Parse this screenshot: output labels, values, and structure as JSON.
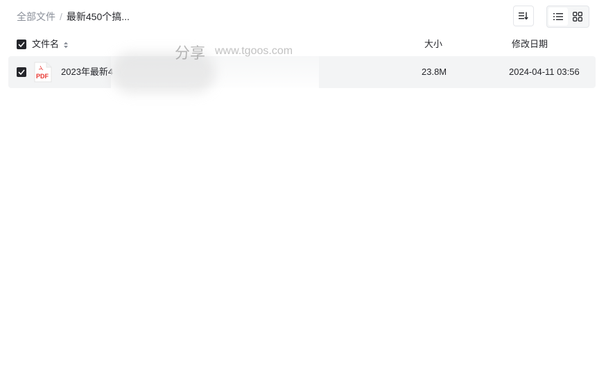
{
  "breadcrumb": {
    "root": "全部文件",
    "separator": "/",
    "current": "最新450个搞..."
  },
  "toolbar": {
    "sort_icon": "sort-descending-icon",
    "view_list_icon": "list-view-icon",
    "view_grid_icon": "grid-view-icon",
    "active_view": "list"
  },
  "table": {
    "headers": {
      "name": "文件名",
      "size": "大小",
      "modified": "修改日期"
    },
    "rows": [
      {
        "name": "2023年最新4",
        "type_icon": "pdf-file-icon",
        "type_label": "PDF",
        "size": "23.8M",
        "modified": "2024-04-11 03:56",
        "selected": true
      }
    ]
  },
  "watermark": {
    "text": "www.tgoos.com",
    "big": "分享"
  },
  "colors": {
    "accent_dark": "#25262b",
    "muted": "#8a8f99",
    "row_selected_bg": "#f3f4f5",
    "pdf_red": "#e8352f"
  }
}
